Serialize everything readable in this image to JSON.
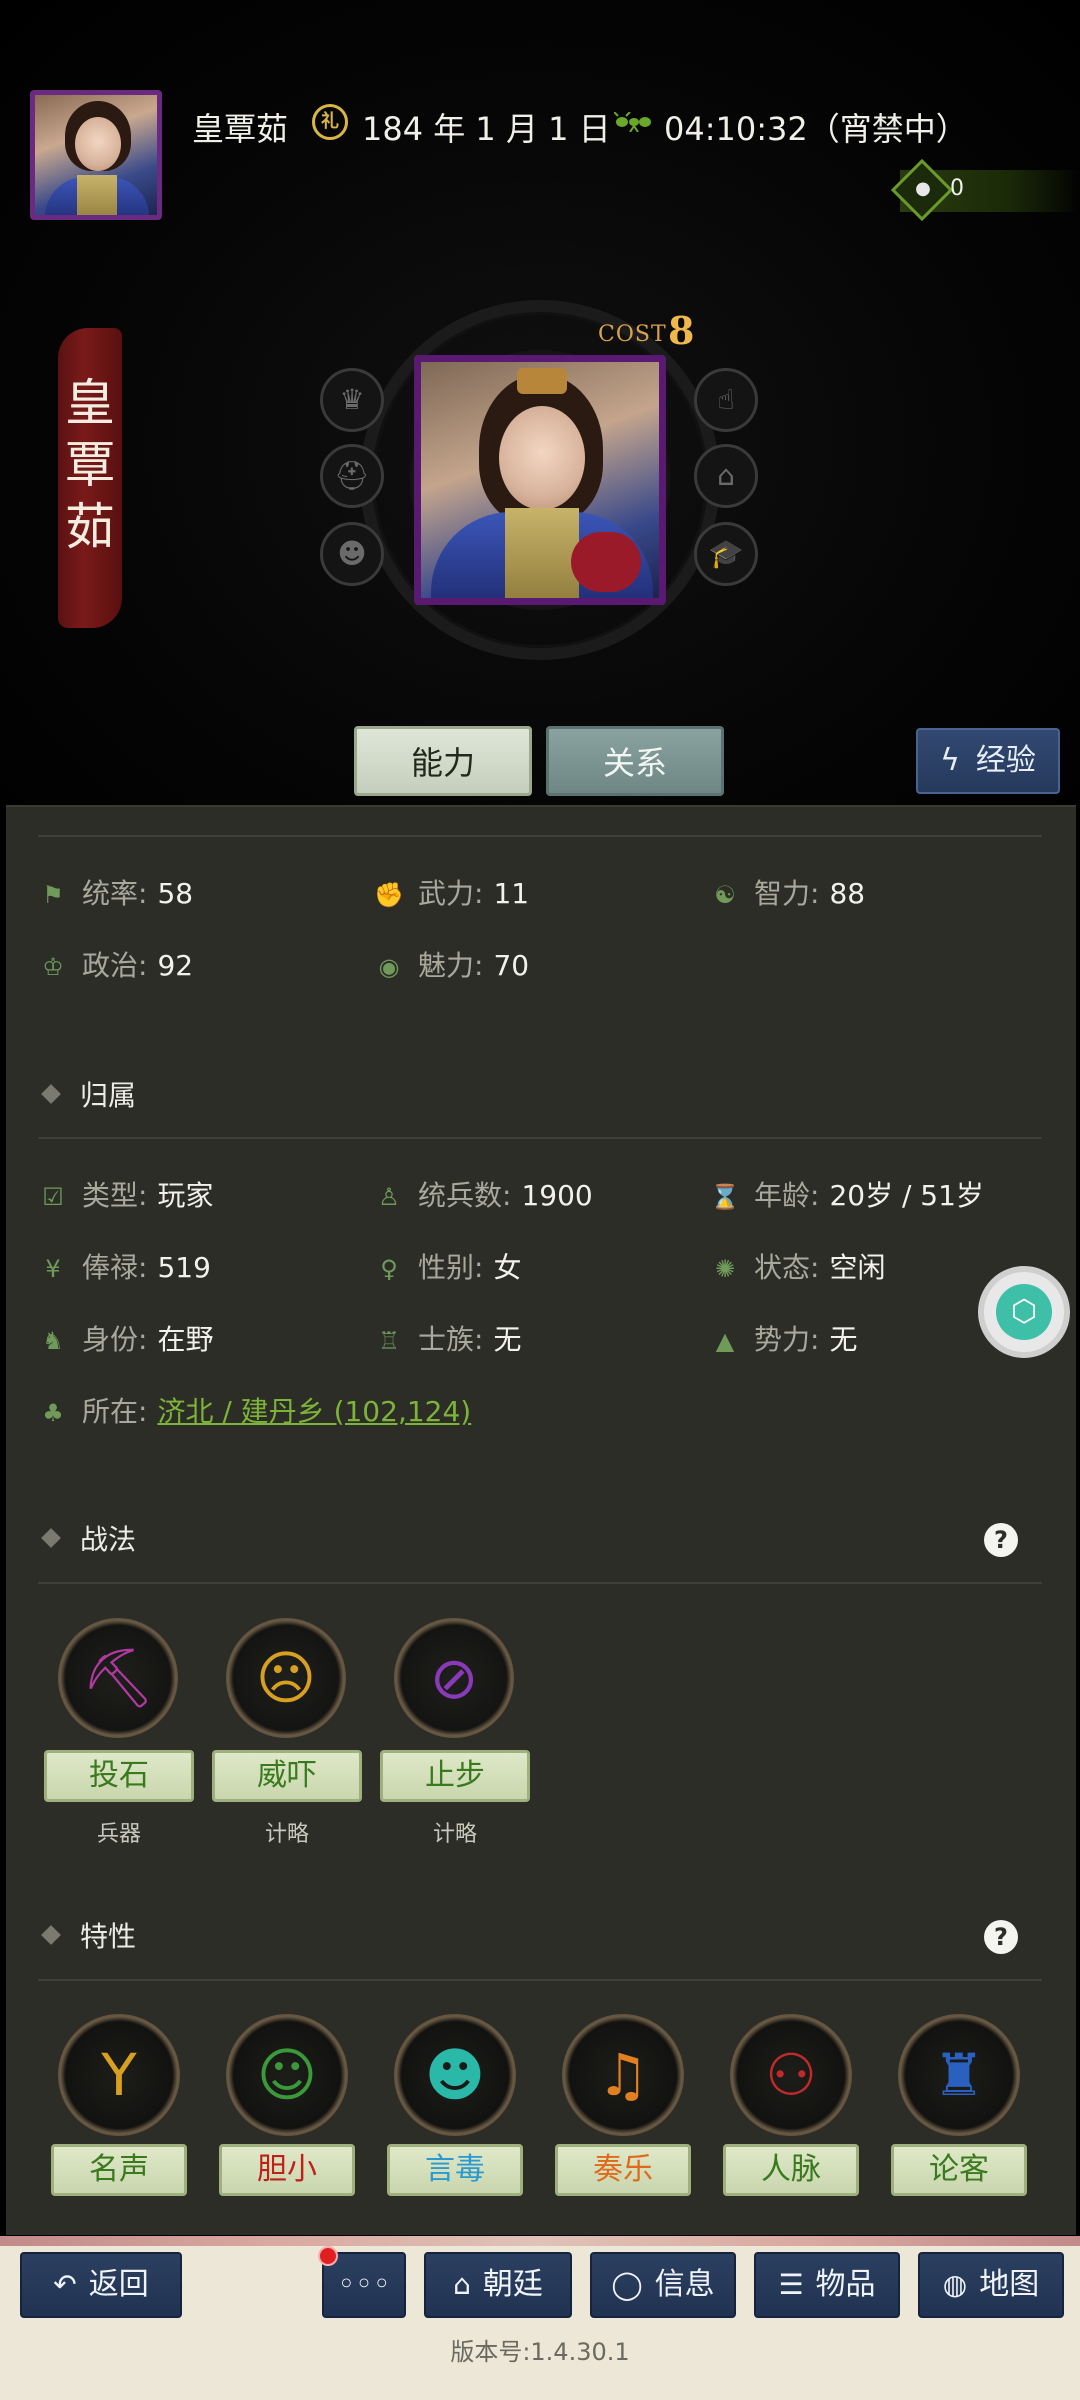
{
  "header": {
    "name": "皇覃茹",
    "date": "184 年 1 月 1 日",
    "time": "04:10:32（宵禁中）",
    "coins": "0"
  },
  "banner_name": [
    "皇",
    "覃",
    "茹"
  ],
  "cost": {
    "label": "COST",
    "value": "8"
  },
  "tabs": {
    "ability": "能力",
    "relation": "关系",
    "experience": "经验"
  },
  "stats": [
    {
      "label": "统率:",
      "value": "58",
      "icon": "flag-icon"
    },
    {
      "label": "武力:",
      "value": "11",
      "icon": "arm-icon"
    },
    {
      "label": "智力:",
      "value": "88",
      "icon": "brain-icon"
    },
    {
      "label": "政治:",
      "value": "92",
      "icon": "crown-icon"
    },
    {
      "label": "魅力:",
      "value": "70",
      "icon": "eye-icon"
    }
  ],
  "affiliation": {
    "title": "归属",
    "rows": [
      {
        "label": "类型:",
        "value": "玩家"
      },
      {
        "label": "统兵数:",
        "value": "1900"
      },
      {
        "label": "年龄:",
        "value": "20岁 / 51岁"
      },
      {
        "label": "俸禄:",
        "value": "519"
      },
      {
        "label": "性别:",
        "value": "女"
      },
      {
        "label": "状态:",
        "value": "空闲"
      },
      {
        "label": "身份:",
        "value": "在野"
      },
      {
        "label": "士族:",
        "value": "无"
      },
      {
        "label": "势力:",
        "value": "无"
      }
    ],
    "location_label": "所在:",
    "location_value": "济北 / 建丹乡 (102,124)"
  },
  "tactics": {
    "title": "战法",
    "help": "?",
    "items": [
      {
        "name": "投石",
        "type": "兵器",
        "color": "#b03aa0"
      },
      {
        "name": "威吓",
        "type": "计略",
        "color": "#d8a020"
      },
      {
        "name": "止步",
        "type": "计略",
        "color": "#8a3ab8"
      }
    ]
  },
  "traits": {
    "title": "特性",
    "help": "?",
    "items": [
      {
        "name": "名声",
        "color": "#3a7a1e",
        "icon_color": "#d8a020"
      },
      {
        "name": "胆小",
        "color": "#c0201a",
        "icon_color": "#3a9a3a"
      },
      {
        "name": "言毒",
        "color": "#2a9ad0",
        "icon_color": "#2ab8a8"
      },
      {
        "name": "奏乐",
        "color": "#e06a1a",
        "icon_color": "#e08020"
      },
      {
        "name": "人脉",
        "color": "#3a7a1e",
        "icon_color": "#c02a2a"
      },
      {
        "name": "论客",
        "color": "#3a7a1e",
        "icon_color": "#2a60c0"
      }
    ]
  },
  "nav": {
    "back": "返回",
    "more": "◦◦◦",
    "court": "朝廷",
    "info": "信息",
    "items": "物品",
    "map": "地图"
  },
  "version": "版本号:1.4.30.1"
}
